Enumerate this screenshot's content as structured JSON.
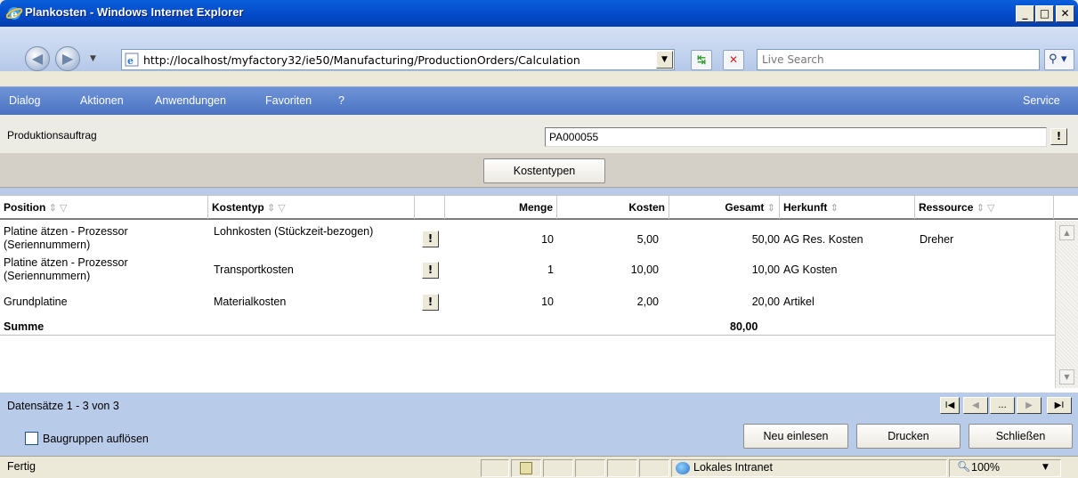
{
  "window": {
    "title": "Plankosten - Windows Internet Explorer",
    "minimize": "_",
    "maximize": "□",
    "close": "✕"
  },
  "browser": {
    "url": "http://localhost/myfactory32/ie50/Manufacturing/ProductionOrders/Calculation",
    "search_placeholder": "Live Search"
  },
  "menu": {
    "items": [
      {
        "label": "Dialog"
      },
      {
        "label": "Aktionen"
      },
      {
        "label": "Anwendungen"
      },
      {
        "label": "Favoriten"
      },
      {
        "label": "?"
      }
    ],
    "service": "Service"
  },
  "form": {
    "label": "Produktionsauftrag",
    "value": "PA000055",
    "lookup_button": "!",
    "kostentypen_button": "Kostentypen"
  },
  "grid": {
    "columns": {
      "position": "Position",
      "kostentyp": "Kostentyp",
      "menge": "Menge",
      "kosten": "Kosten",
      "gesamt": "Gesamt",
      "herkunft": "Herkunft",
      "ressource": "Ressource"
    },
    "rows": [
      {
        "position": "Platine ätzen - Prozessor (Seriennummern)",
        "kostentyp": "Lohnkosten (Stückzeit-bezogen)",
        "action": "!",
        "menge": "10",
        "kosten": "5,00",
        "gesamt": "50,00",
        "herkunft": "AG Res. Kosten",
        "ressource": "Dreher"
      },
      {
        "position": "Platine ätzen - Prozessor (Seriennummern)",
        "kostentyp": "Transportkosten",
        "action": "!",
        "menge": "1",
        "kosten": "10,00",
        "gesamt": "10,00",
        "herkunft": "AG Kosten",
        "ressource": ""
      },
      {
        "position": "Grundplatine",
        "kostentyp": "Materialkosten",
        "action": "!",
        "menge": "10",
        "kosten": "2,00",
        "gesamt": "20,00",
        "herkunft": "Artikel",
        "ressource": ""
      }
    ],
    "sum_label": "Summe",
    "sum_value": "80,00"
  },
  "footer": {
    "records": "Datensätze 1 - 3 von 3",
    "pager": {
      "first": "I◀",
      "prev": "◀",
      "more": "...",
      "next": "▶",
      "last": "▶I"
    },
    "checkbox_label": "Baugruppen auflösen",
    "buttons": {
      "reload": "Neu einlesen",
      "print": "Drucken",
      "close": "Schließen"
    }
  },
  "status": {
    "text": "Fertig",
    "zone": "Lokales Intranet",
    "zoom": "100%"
  }
}
